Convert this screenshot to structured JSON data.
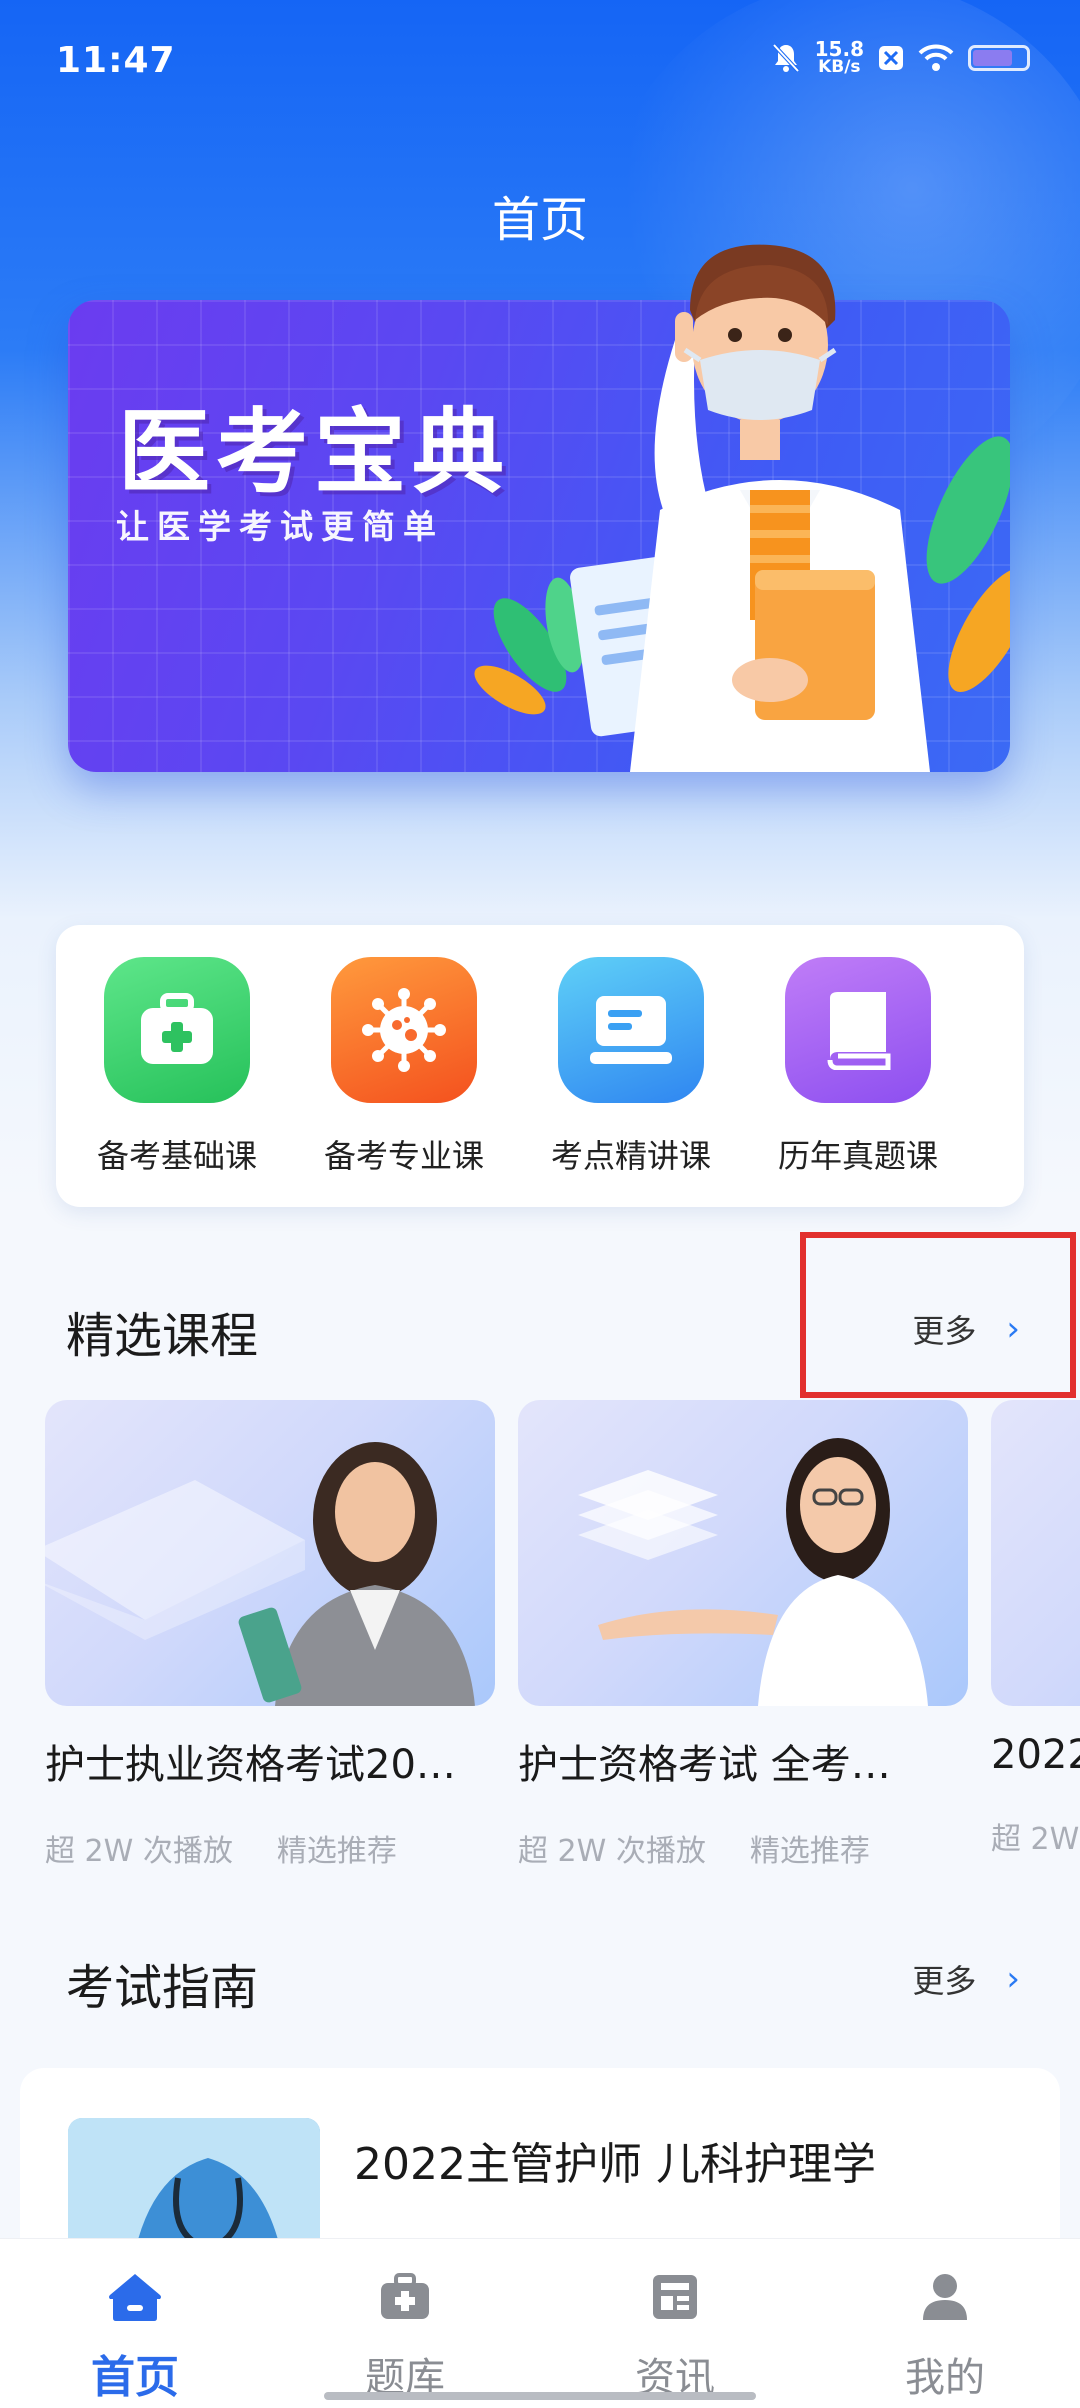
{
  "status_bar": {
    "time": "11:47",
    "net_speed": "15.8",
    "net_unit": "KB/s"
  },
  "header": {
    "title": "首页"
  },
  "banner": {
    "title": "医考宝典",
    "subtitle": "让医学考试更简单"
  },
  "categories": [
    {
      "label": "备考基础课",
      "icon": "medical-kit-icon",
      "color": "#3ecf6a"
    },
    {
      "label": "备考专业课",
      "icon": "virus-icon",
      "color": "#f86a2e"
    },
    {
      "label": "考点精讲课",
      "icon": "monitor-icon",
      "color": "#3aa0f3"
    },
    {
      "label": "历年真题课",
      "icon": "book-icon",
      "color": "#a462f0"
    }
  ],
  "featured": {
    "title": "精选课程",
    "more_label": "更多",
    "courses": [
      {
        "title": "护士执业资格考试20…",
        "plays": "超 2W 次播放",
        "tag": "精选推荐"
      },
      {
        "title": "护士资格考试 全考…",
        "plays": "超 2W 次播放",
        "tag": "精选推荐"
      },
      {
        "title": "2022",
        "plays": "超 2W",
        "tag": ""
      }
    ]
  },
  "guide": {
    "title": "考试指南",
    "more_label": "更多",
    "items": [
      {
        "title": "2022主管护师 儿科护理学"
      }
    ]
  },
  "bottom_nav": [
    {
      "label": "首页",
      "icon": "home-icon",
      "active": true
    },
    {
      "label": "题库",
      "icon": "question-bank-icon",
      "active": false
    },
    {
      "label": "资讯",
      "icon": "news-icon",
      "active": false
    },
    {
      "label": "我的",
      "icon": "profile-icon",
      "active": false
    }
  ],
  "colors": {
    "primary": "#2b6bea",
    "highlight": "#e2302e"
  }
}
